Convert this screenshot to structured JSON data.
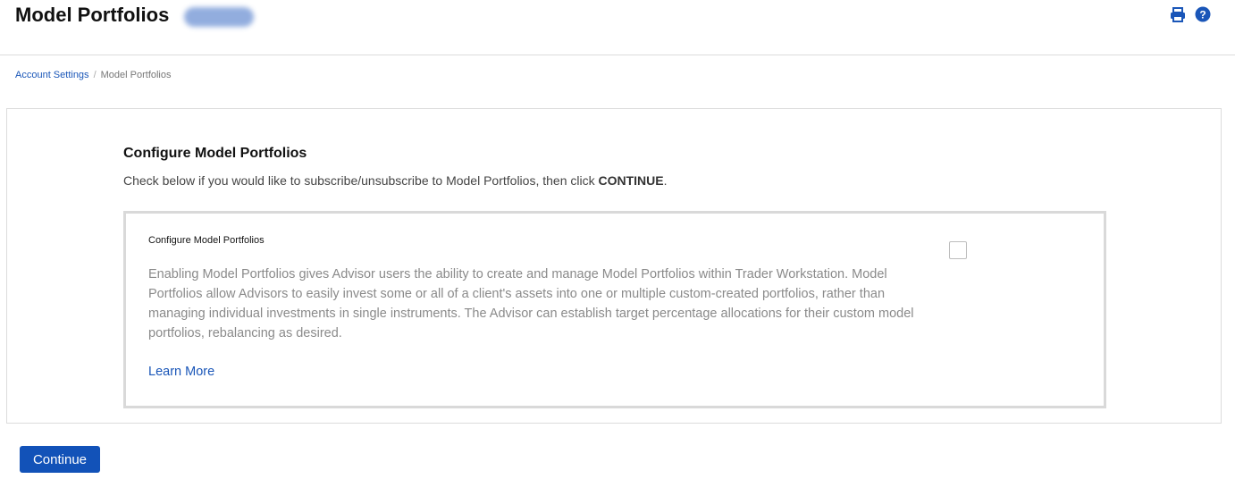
{
  "header": {
    "title": "Model Portfolios"
  },
  "icons": {
    "print": "print-icon",
    "help": "help-icon",
    "accent": "#1a56b8"
  },
  "breadcrumb": {
    "items": [
      "Account Settings",
      "Model Portfolios"
    ],
    "separator": "/"
  },
  "section": {
    "title": "Configure Model Portfolios",
    "desc_prefix": "Check below if you would like to subscribe/unsubscribe to Model Portfolios, then click ",
    "desc_strong": "CONTINUE",
    "desc_suffix": "."
  },
  "card": {
    "title": "Configure Model Portfolios",
    "body": "Enabling Model Portfolios gives Advisor users the ability to create and manage Model Portfolios within Trader Workstation. Model Portfolios allow Advisors to easily invest some or all of a client's assets into one or multiple custom-created portfolios, rather than managing individual investments in single instruments. The Advisor can establish target percentage allocations for their custom model portfolios, rebalancing as desired.",
    "link": "Learn More",
    "checked": false
  },
  "actions": {
    "continue": "Continue"
  }
}
